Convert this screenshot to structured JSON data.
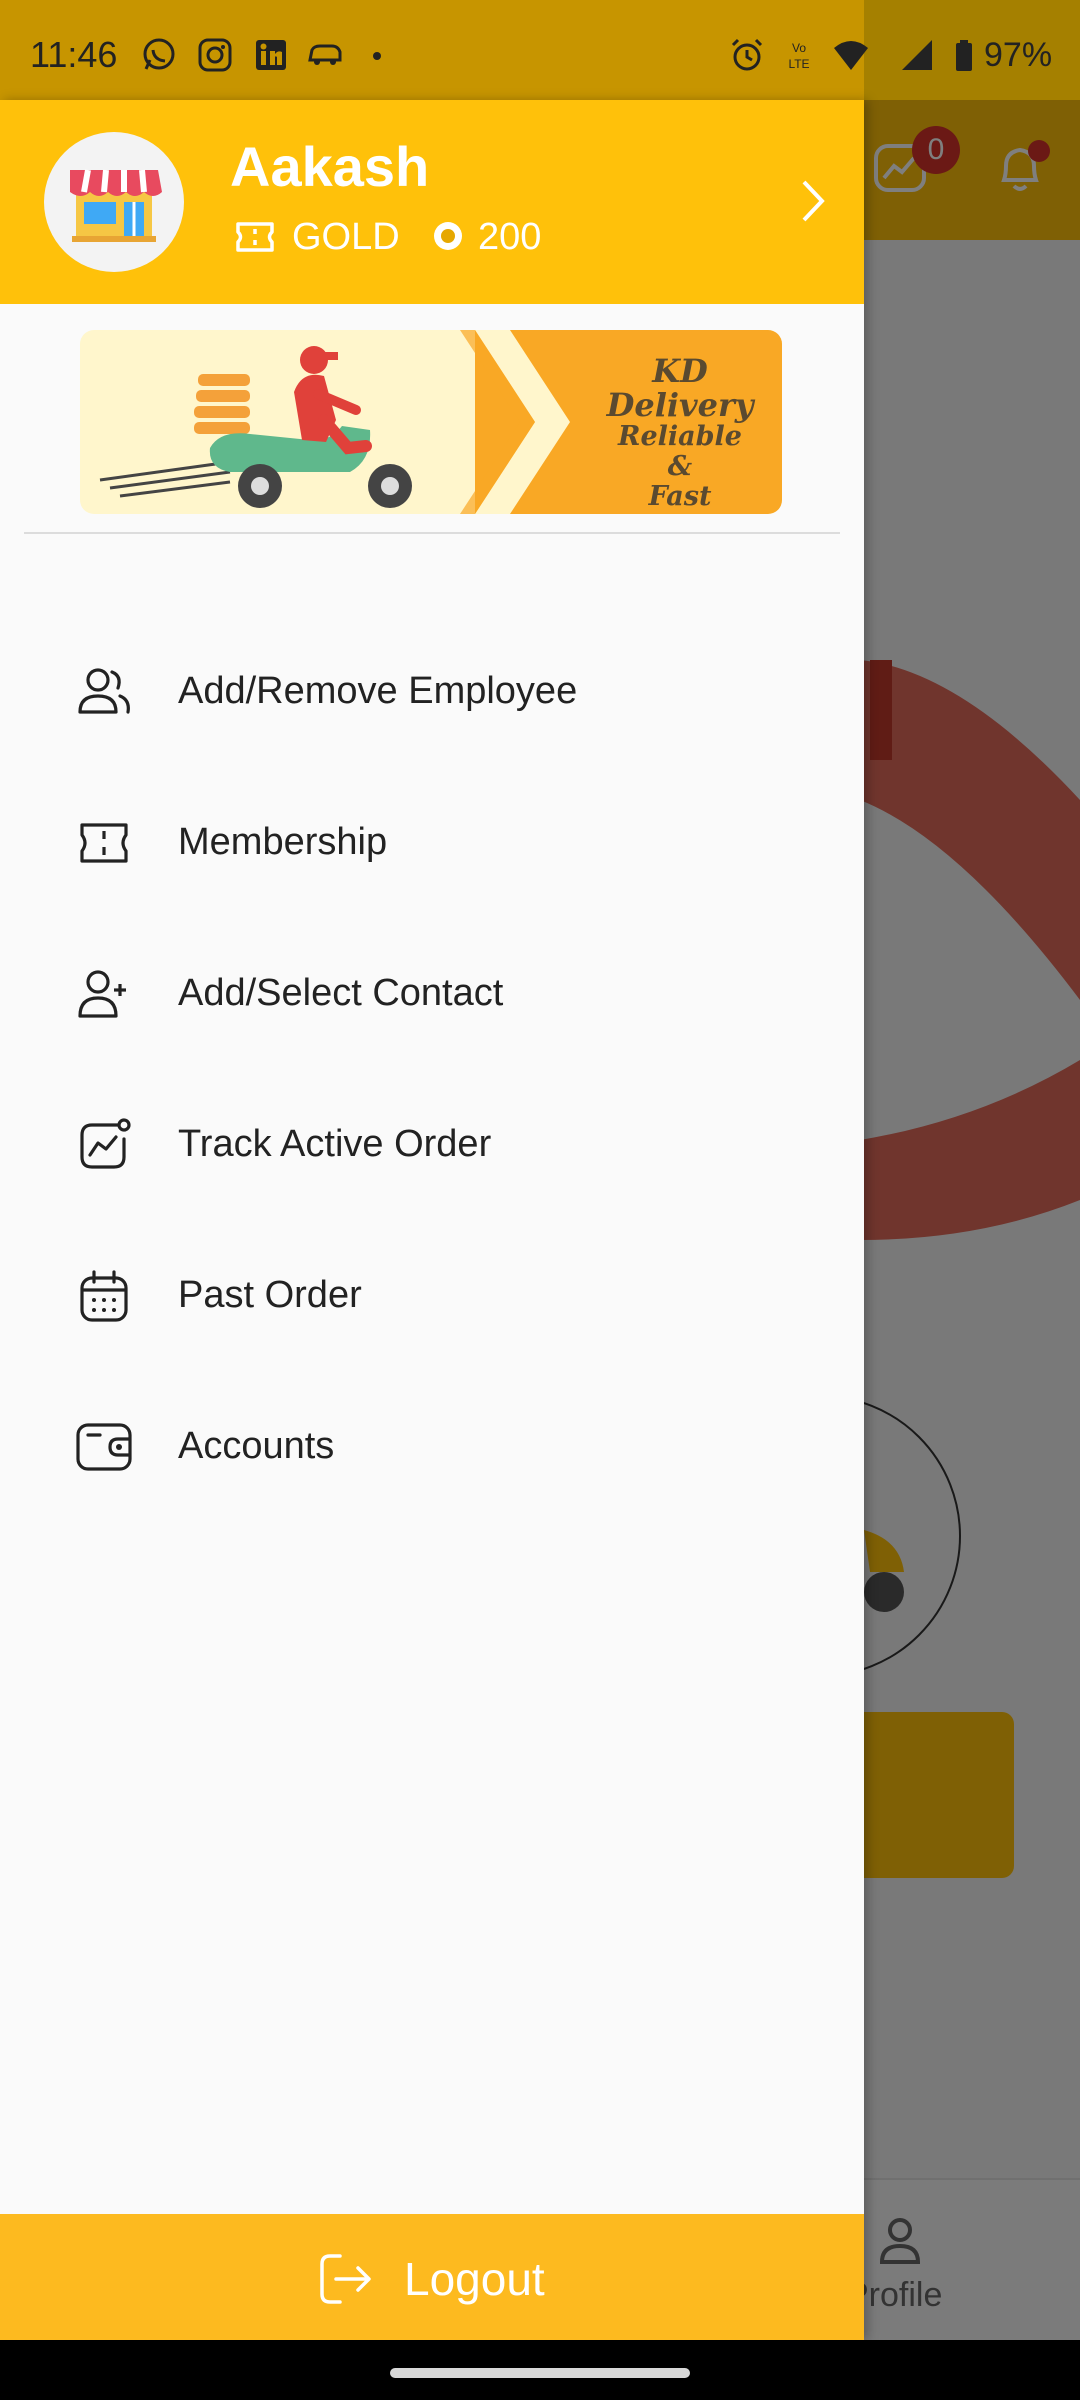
{
  "status_bar": {
    "time": "11:46",
    "battery_text": "97%",
    "left_icons": [
      "whatsapp-icon",
      "instagram-icon",
      "linkedin-icon",
      "car-icon",
      "dot-icon"
    ],
    "right_icons": [
      "alarm-icon",
      "volte-icon",
      "wifi-icon",
      "signal-icon",
      "battery-icon"
    ]
  },
  "drawer": {
    "user": {
      "name": "Aakash",
      "tier": "GOLD",
      "points": "200",
      "avatar_icon": "shop-icon"
    },
    "banner": {
      "title": "KD Delivery",
      "line1": "Reliable",
      "line2": "&",
      "line3": "Fast"
    },
    "menu": [
      {
        "label": "Add/Remove Employee",
        "icon": "users-icon"
      },
      {
        "label": "Membership",
        "icon": "ticket-icon"
      },
      {
        "label": "Add/Select Contact",
        "icon": "user-plus-icon"
      },
      {
        "label": "Track Active Order",
        "icon": "activity-icon"
      },
      {
        "label": "Past Order",
        "icon": "calendar-icon"
      },
      {
        "label": "Accounts",
        "icon": "wallet-icon"
      }
    ],
    "logout_label": "Logout"
  },
  "background": {
    "notification_count": "0",
    "profile_label": "Profile"
  },
  "colors": {
    "primary": "#FFC10A",
    "logout": "#FDBA1F",
    "statusbar": "#C79500",
    "badge": "#D6332A"
  }
}
